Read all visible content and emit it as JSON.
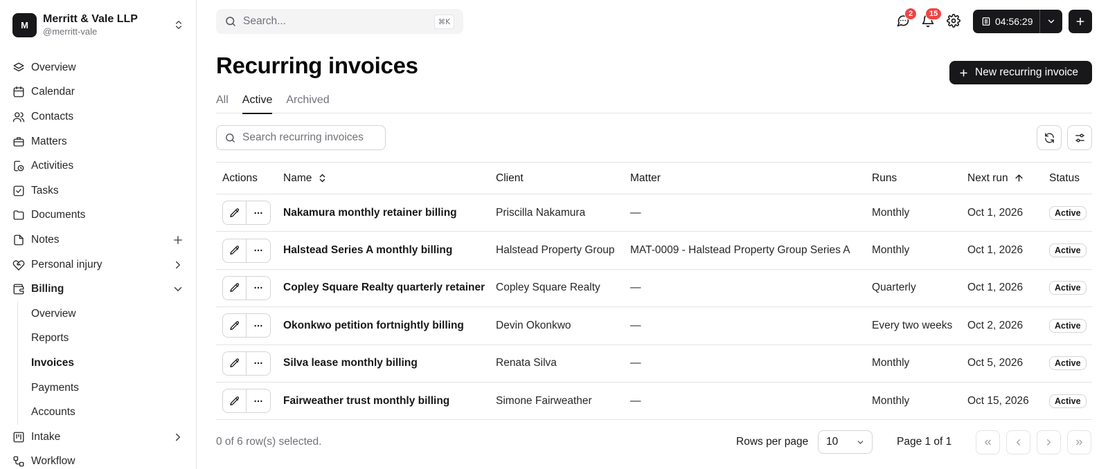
{
  "org": {
    "initial": "M",
    "name": "Merritt & Vale LLP",
    "handle": "@merritt-vale"
  },
  "nav": {
    "overview": "Overview",
    "calendar": "Calendar",
    "contacts": "Contacts",
    "matters": "Matters",
    "activities": "Activities",
    "tasks": "Tasks",
    "documents": "Documents",
    "notes": "Notes",
    "personal_injury": "Personal injury",
    "billing": "Billing",
    "billing_sub": [
      "Overview",
      "Reports",
      "Invoices",
      "Payments",
      "Accounts"
    ],
    "intake": "Intake",
    "workflow": "Workflow"
  },
  "topbar": {
    "search_placeholder": "Search...",
    "shortcut": "⌘K",
    "messages_badge": "2",
    "notifications_badge": "15",
    "timer": "04:56:29"
  },
  "page": {
    "title": "Recurring invoices",
    "new_button": "New recurring invoice",
    "tabs": [
      "All",
      "Active",
      "Archived"
    ],
    "active_tab": "Active",
    "list_search_placeholder": "Search recurring invoices"
  },
  "table": {
    "headers": {
      "actions": "Actions",
      "name": "Name",
      "client": "Client",
      "matter": "Matter",
      "runs": "Runs",
      "next_run": "Next run",
      "status": "Status"
    },
    "rows": [
      {
        "name": "Nakamura monthly retainer billing",
        "client": "Priscilla Nakamura",
        "matter": "—",
        "runs": "Monthly",
        "next_run": "Oct 1, 2026",
        "status": "Active"
      },
      {
        "name": "Halstead Series A monthly billing",
        "client": "Halstead Property Group",
        "matter": "MAT-0009 - Halstead Property Group Series A",
        "runs": "Monthly",
        "next_run": "Oct 1, 2026",
        "status": "Active"
      },
      {
        "name": "Copley Square Realty quarterly retainer",
        "client": "Copley Square Realty",
        "matter": "—",
        "runs": "Quarterly",
        "next_run": "Oct 1, 2026",
        "status": "Active"
      },
      {
        "name": "Okonkwo petition fortnightly billing",
        "client": "Devin Okonkwo",
        "matter": "—",
        "runs": "Every two weeks",
        "next_run": "Oct 2, 2026",
        "status": "Active"
      },
      {
        "name": "Silva lease monthly billing",
        "client": "Renata Silva",
        "matter": "—",
        "runs": "Monthly",
        "next_run": "Oct 5, 2026",
        "status": "Active"
      },
      {
        "name": "Fairweather trust monthly billing",
        "client": "Simone Fairweather",
        "matter": "—",
        "runs": "Monthly",
        "next_run": "Oct 15, 2026",
        "status": "Active"
      }
    ]
  },
  "footer": {
    "selection": "0 of 6 row(s) selected.",
    "rows_per_page_label": "Rows per page",
    "rows_per_page": "10",
    "page_info": "Page 1 of 1"
  }
}
